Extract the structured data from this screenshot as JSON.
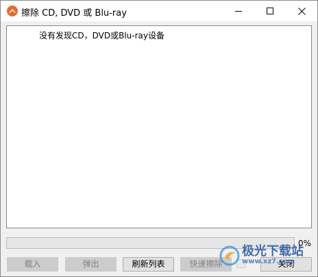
{
  "window": {
    "title": "擦除 CD, DVD 或 Blu-ray",
    "app_icon": "eraser-app-icon",
    "controls": {
      "minimize_icon": "minimize-icon",
      "maximize_icon": "maximize-icon",
      "close_icon": "close-icon"
    }
  },
  "device_list": {
    "message": "没有发现CD，DVD或Blu-ray设备"
  },
  "progress": {
    "value_percent": 0,
    "label": "0%"
  },
  "buttons": {
    "load": {
      "label": "载入",
      "enabled": false
    },
    "eject": {
      "label": "弹出",
      "enabled": false
    },
    "refresh": {
      "label": "刷新列表",
      "enabled": true
    },
    "quick_erase": {
      "label": "快速擦除",
      "enabled": false
    },
    "close": {
      "label": "关闭",
      "enabled": true
    }
  },
  "watermark": {
    "line1": "极光下载站",
    "line2": "www.xz7.com"
  },
  "colors": {
    "app_icon_orange": "#e8692f",
    "progress_fill": "#06b025",
    "watermark_blue": "#1c4b9c"
  }
}
